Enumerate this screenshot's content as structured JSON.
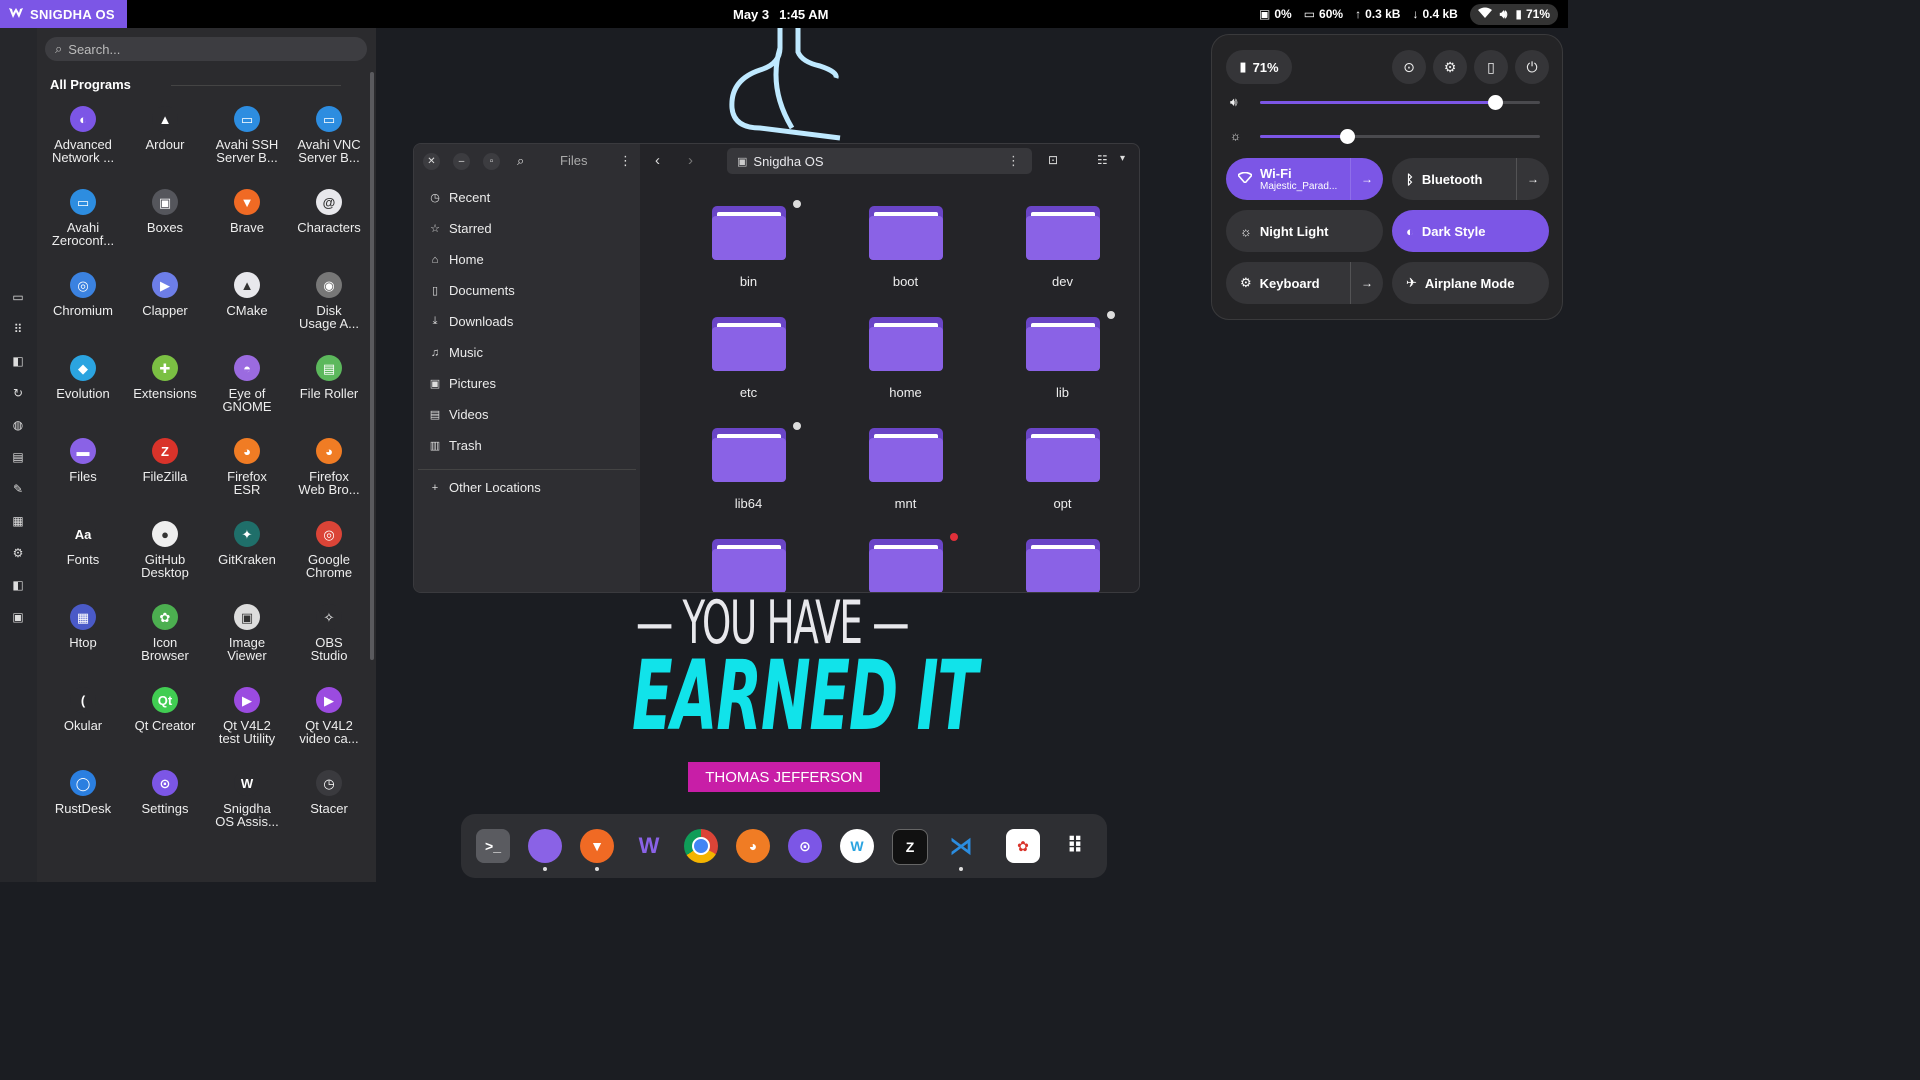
{
  "topbar": {
    "brand": "SNIGDHA OS",
    "date": "May 3",
    "time": "1:45 AM",
    "cpu": "0%",
    "memory": "60%",
    "upload": "0.3 kB",
    "download": "0.4 kB",
    "battery": "71%"
  },
  "menu": {
    "search_placeholder": "Search...",
    "section_title": "All Programs",
    "apps": [
      {
        "l1": "Advanced",
        "l2": "Network ...",
        "color": "#7c56e6",
        "glyph": "◐"
      },
      {
        "l1": "Ardour",
        "l2": "",
        "color": "#2b2b2e",
        "glyph": "▲"
      },
      {
        "l1": "Avahi SSH",
        "l2": "Server B...",
        "color": "#2d8de0",
        "glyph": "▭"
      },
      {
        "l1": "Avahi VNC",
        "l2": "Server B...",
        "color": "#2d8de0",
        "glyph": "▭"
      },
      {
        "l1": "Avahi",
        "l2": "Zeroconf...",
        "color": "#2d8de0",
        "glyph": "▭"
      },
      {
        "l1": "Boxes",
        "l2": "",
        "color": "#55565c",
        "glyph": "▣"
      },
      {
        "l1": "Brave",
        "l2": "",
        "color": "#f06a24",
        "glyph": "▼"
      },
      {
        "l1": "Characters",
        "l2": "",
        "color": "#e8e8ec",
        "glyph": "@"
      },
      {
        "l1": "Chromium",
        "l2": "",
        "color": "#3b82e0",
        "glyph": "◎"
      },
      {
        "l1": "Clapper",
        "l2": "",
        "color": "#6d7ee8",
        "glyph": "▶"
      },
      {
        "l1": "CMake",
        "l2": "",
        "color": "#e8e8ec",
        "glyph": "▲"
      },
      {
        "l1": "Disk",
        "l2": "Usage A...",
        "color": "#777",
        "glyph": "◉"
      },
      {
        "l1": "Evolution",
        "l2": "",
        "color": "#2ba4e0",
        "glyph": "◆"
      },
      {
        "l1": "Extensions",
        "l2": "",
        "color": "#7bc043",
        "glyph": "✚"
      },
      {
        "l1": "Eye of",
        "l2": "GNOME",
        "color": "#9b6be0",
        "glyph": "◓"
      },
      {
        "l1": "File Roller",
        "l2": "",
        "color": "#5cb85c",
        "glyph": "▤"
      },
      {
        "l1": "Files",
        "l2": "",
        "color": "#8a62e6",
        "glyph": "▬"
      },
      {
        "l1": "FileZilla",
        "l2": "",
        "color": "#d9332a",
        "glyph": "Z"
      },
      {
        "l1": "Firefox",
        "l2": "ESR",
        "color": "#f07c24",
        "glyph": "◕"
      },
      {
        "l1": "Firefox",
        "l2": "Web Bro...",
        "color": "#f07c24",
        "glyph": "◕"
      },
      {
        "l1": "Fonts",
        "l2": "",
        "color": "#2b2b2e",
        "glyph": "Aa"
      },
      {
        "l1": "GitHub",
        "l2": "Desktop",
        "color": "#eee",
        "glyph": "●"
      },
      {
        "l1": "GitKraken",
        "l2": "",
        "color": "#1f6f6a",
        "glyph": "✦"
      },
      {
        "l1": "Google",
        "l2": "Chrome",
        "color": "#db4437",
        "glyph": "◎"
      },
      {
        "l1": "Htop",
        "l2": "",
        "color": "#4a5ac7",
        "glyph": "▦"
      },
      {
        "l1": "Icon",
        "l2": "Browser",
        "color": "#4caf50",
        "glyph": "✿"
      },
      {
        "l1": "Image",
        "l2": "Viewer",
        "color": "#ddd",
        "glyph": "▣"
      },
      {
        "l1": "OBS",
        "l2": "Studio",
        "color": "#2b2b2e",
        "glyph": "✧"
      },
      {
        "l1": "Okular",
        "l2": "",
        "color": "#2b2b2e",
        "glyph": "("
      },
      {
        "l1": "Qt Creator",
        "l2": "",
        "color": "#41cd52",
        "glyph": "Qt"
      },
      {
        "l1": "Qt V4L2",
        "l2": "test Utility",
        "color": "#9b4be0",
        "glyph": "▶"
      },
      {
        "l1": "Qt V4L2",
        "l2": "video ca...",
        "color": "#9b4be0",
        "glyph": "▶"
      },
      {
        "l1": "RustDesk",
        "l2": "",
        "color": "#2b7fe0",
        "glyph": "◯"
      },
      {
        "l1": "Settings",
        "l2": "",
        "color": "#7c56e6",
        "glyph": "⊙"
      },
      {
        "l1": "Snigdha",
        "l2": "OS Assis...",
        "color": "#2b2b2e",
        "glyph": "W"
      },
      {
        "l1": "Stacer",
        "l2": "",
        "color": "#3a3a3e",
        "glyph": "◷"
      }
    ]
  },
  "wallpaper": {
    "line1": "— YOU HAVE —",
    "line2": "EARNED IT",
    "author": "THOMAS JEFFERSON"
  },
  "files": {
    "title": "Files",
    "path": "Snigdha OS",
    "sidebar": [
      {
        "label": "Recent",
        "icon": "clock-icon"
      },
      {
        "label": "Starred",
        "icon": "star-icon"
      },
      {
        "label": "Home",
        "icon": "home-icon"
      },
      {
        "label": "Documents",
        "icon": "document-icon"
      },
      {
        "label": "Downloads",
        "icon": "download-icon"
      },
      {
        "label": "Music",
        "icon": "music-icon"
      },
      {
        "label": "Pictures",
        "icon": "picture-icon"
      },
      {
        "label": "Videos",
        "icon": "video-icon"
      },
      {
        "label": "Trash",
        "icon": "trash-icon"
      }
    ],
    "other_locations": "Other Locations",
    "folders": [
      "bin",
      "boot",
      "dev",
      "etc",
      "home",
      "lib",
      "lib64",
      "mnt",
      "opt",
      "",
      "",
      ""
    ]
  },
  "quick_settings": {
    "battery": "71%",
    "volume_level": 0.84,
    "brightness_level": 0.31,
    "wifi_label": "Wi-Fi",
    "wifi_network": "Majestic_Parad...",
    "bluetooth_label": "Bluetooth",
    "night_light_label": "Night Light",
    "dark_style_label": "Dark Style",
    "keyboard_label": "Keyboard",
    "airplane_label": "Airplane Mode",
    "accent": "#7c56e6"
  }
}
